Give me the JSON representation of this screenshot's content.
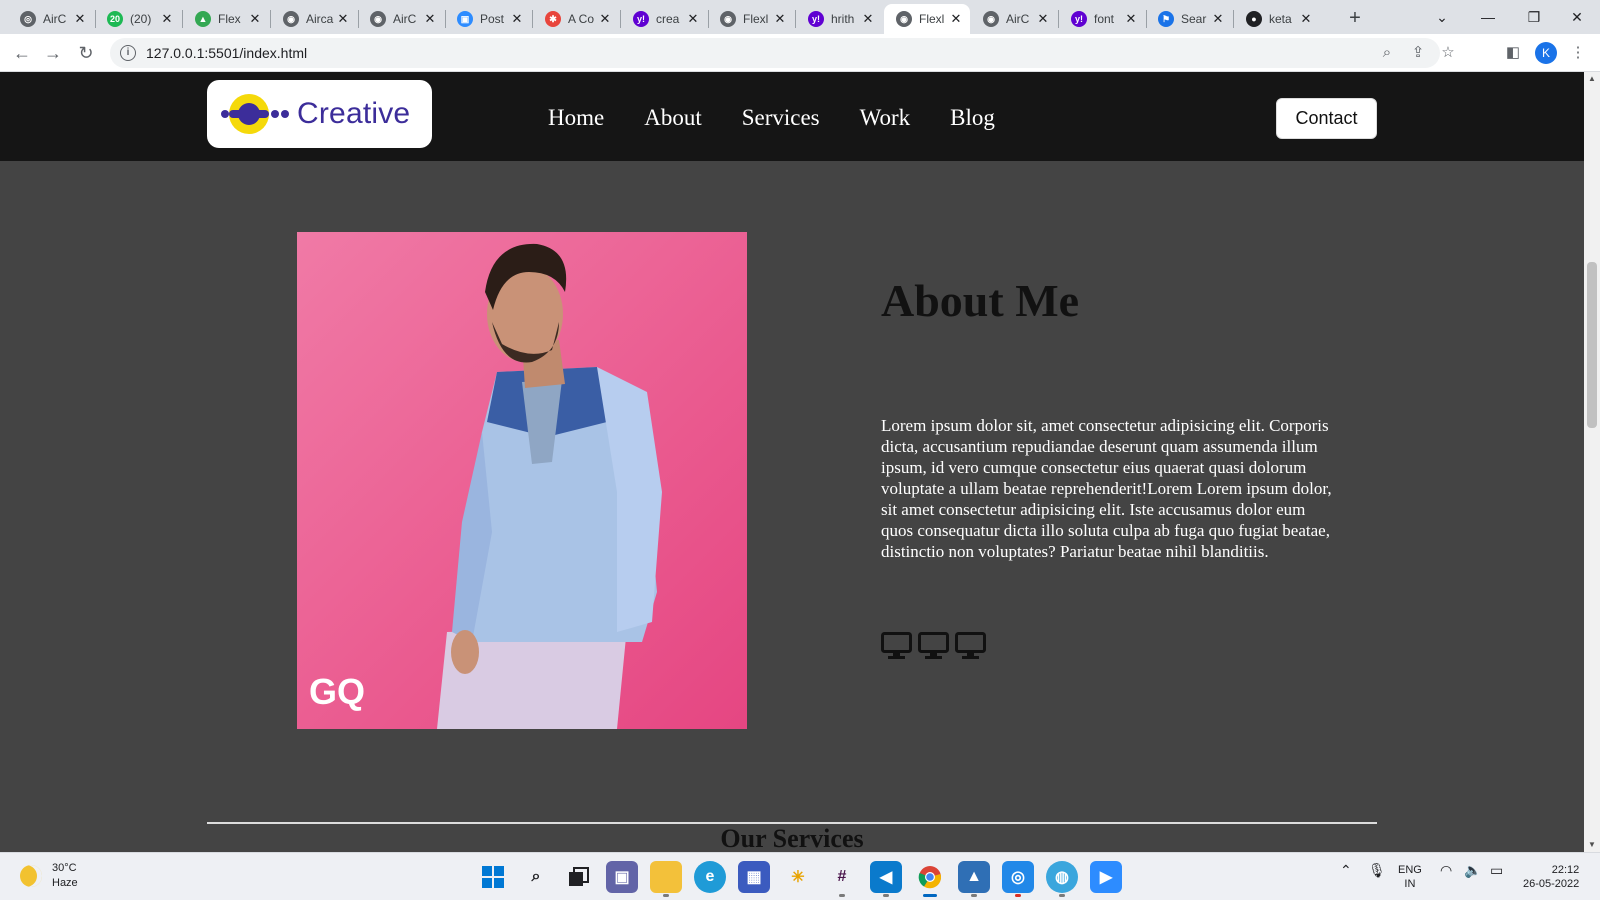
{
  "browser": {
    "tabs": [
      {
        "title": "AirC",
        "favicon_color": "#5f6368",
        "favicon_glyph": "◎"
      },
      {
        "title": "(20)",
        "favicon_color": "#1db954",
        "favicon_glyph": "20"
      },
      {
        "title": "Flex",
        "favicon_color": "#34a853",
        "favicon_glyph": "▲"
      },
      {
        "title": "Airca",
        "favicon_color": "#5f6368",
        "favicon_glyph": "◉"
      },
      {
        "title": "AirC",
        "favicon_color": "#5f6368",
        "favicon_glyph": "◉"
      },
      {
        "title": "Post",
        "favicon_color": "#2d8cff",
        "favicon_glyph": "▣"
      },
      {
        "title": "A Co",
        "favicon_color": "#e8453c",
        "favicon_glyph": "✱"
      },
      {
        "title": "crea",
        "favicon_color": "#6001d2",
        "favicon_glyph": "y!"
      },
      {
        "title": "Flexl",
        "favicon_color": "#5f6368",
        "favicon_glyph": "◉"
      },
      {
        "title": "hrith",
        "favicon_color": "#6001d2",
        "favicon_glyph": "y!"
      },
      {
        "title": "Flexl",
        "favicon_color": "#5f6368",
        "favicon_glyph": "◉",
        "active": true
      },
      {
        "title": "AirC",
        "favicon_color": "#5f6368",
        "favicon_glyph": "◉"
      },
      {
        "title": "font",
        "favicon_color": "#6001d2",
        "favicon_glyph": "y!"
      },
      {
        "title": "Sear",
        "favicon_color": "#1a73e8",
        "favicon_glyph": "⚑"
      },
      {
        "title": "keta",
        "favicon_color": "#202124",
        "favicon_glyph": "●"
      }
    ],
    "close_glyph": "✕",
    "new_tab_glyph": "+",
    "url": "127.0.0.1:5501/index.html",
    "profile_initial": "K"
  },
  "site": {
    "logo_text": "Creative",
    "nav": [
      "Home",
      "About",
      "Services",
      "Work",
      "Blog"
    ],
    "contact_label": "Contact",
    "photo_watermark": "GQ",
    "about_title": "About Me",
    "about_text": "Lorem ipsum dolor sit, amet consectetur adipisicing elit. Corporis dicta, accusantium repudiandae deserunt quam assumenda illum ipsum, id vero cumque consectetur eius quaerat quasi dolorum voluptate a ullam beatae reprehenderit!Lorem Lorem ipsum dolor, sit amet consectetur adipisicing elit. Iste accusamus dolor eum quos consequatur dicta illo soluta culpa ab fuga quo fugiat beatae, distinctio non voluptates? Pariatur beatae nihil blanditiis.",
    "icons": [
      "monitor-icon",
      "monitor-icon",
      "monitor-icon"
    ],
    "services_title": "Our Services",
    "colors": {
      "nav_bg": "#151515",
      "page_bg": "#444444",
      "logo_purple": "#3c2d9a",
      "logo_yellow": "#f5d90a"
    }
  },
  "taskbar": {
    "weather_temp": "30°C",
    "weather_desc": "Haze",
    "lang_top": "ENG",
    "lang_bottom": "IN",
    "time": "22:12",
    "date": "26-05-2022"
  }
}
